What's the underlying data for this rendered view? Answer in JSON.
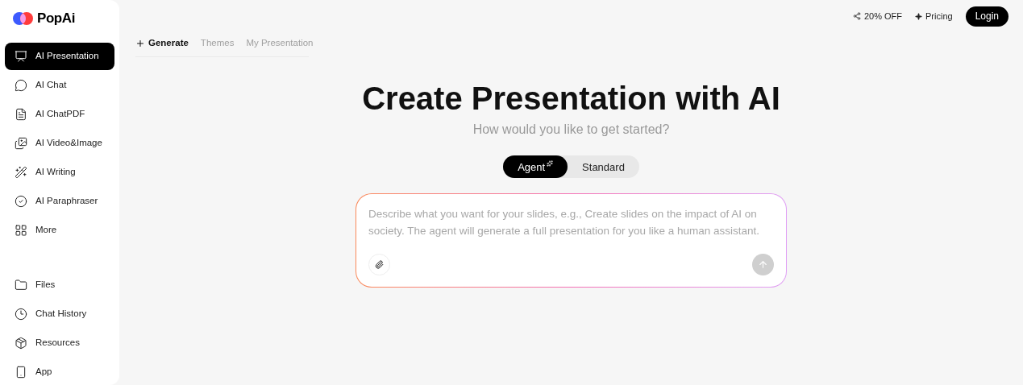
{
  "logo": {
    "text": "PopAi"
  },
  "sidebar": {
    "items": [
      {
        "label": "AI Presentation",
        "selected": true
      },
      {
        "label": "AI Chat",
        "selected": false
      },
      {
        "label": "AI ChatPDF",
        "selected": false
      },
      {
        "label": "AI Video&Image",
        "selected": false
      },
      {
        "label": "AI Writing",
        "selected": false
      },
      {
        "label": "AI Paraphraser",
        "selected": false
      },
      {
        "label": "More",
        "selected": false
      }
    ],
    "bottom_items": [
      {
        "label": "Files"
      },
      {
        "label": "Chat History"
      },
      {
        "label": "Resources"
      },
      {
        "label": "App"
      }
    ]
  },
  "header": {
    "promo": "20% OFF",
    "pricing": "Pricing",
    "login": "Login"
  },
  "tabs": [
    {
      "label": "Generate",
      "selected": true
    },
    {
      "label": "Themes",
      "selected": false
    },
    {
      "label": "My Presentation",
      "selected": false
    }
  ],
  "hero": {
    "title": "Create Presentation with AI",
    "subtitle": "How would you like to get started?"
  },
  "modes": [
    {
      "label": "Agent",
      "selected": true
    },
    {
      "label": "Standard",
      "selected": false
    }
  ],
  "prompt": {
    "placeholder": "Describe what you want for your slides, e.g., Create slides on the impact of AI on society. The agent will generate a full presentation for you like a human assistant."
  }
}
